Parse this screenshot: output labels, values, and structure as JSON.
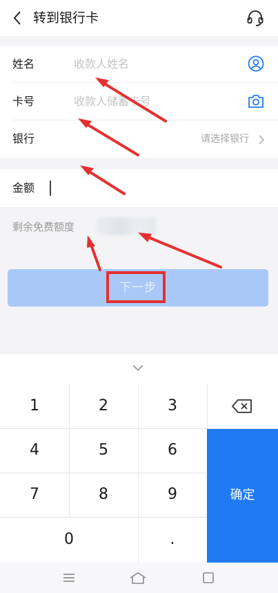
{
  "header": {
    "title": "转到银行卡",
    "back_icon": "back-arrow-icon",
    "service_icon": "headset-icon"
  },
  "form": {
    "name_label": "姓名",
    "name_placeholder": "收款人姓名",
    "card_label": "卡号",
    "card_placeholder": "收款人储蓄卡号",
    "bank_label": "银行",
    "bank_placeholder": "请选择银行",
    "amount_label": "金额",
    "remaining_label": "剩余免费额度"
  },
  "buttons": {
    "next_label": "下一步"
  },
  "keypad": {
    "keys": [
      "1",
      "2",
      "3",
      "4",
      "5",
      "6",
      "7",
      "8",
      "9",
      "0",
      "."
    ],
    "confirm_label": "确定",
    "delete_icon": "backspace-icon",
    "collapse_icon": "chevron-down-icon"
  },
  "colors": {
    "accent": "#1f7af3",
    "button_disabled": "#a9c8f8",
    "annotation": "#e53030"
  }
}
